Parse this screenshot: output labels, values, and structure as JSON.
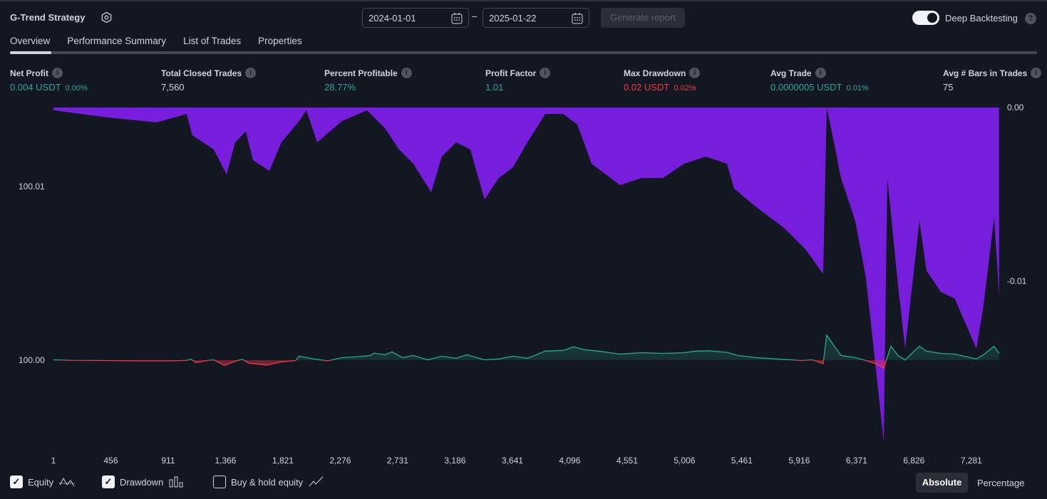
{
  "header": {
    "title": "G-Trend Strategy",
    "start_date": "2024-01-01",
    "end_date": "2025-01-22",
    "separator": "–",
    "generate_label": "Generate report",
    "deep_backtesting_label": "Deep Backtesting",
    "deep_backtesting_on": true,
    "help": "?"
  },
  "tabs": [
    {
      "label": "Overview",
      "active": true
    },
    {
      "label": "Performance Summary"
    },
    {
      "label": "List of Trades"
    },
    {
      "label": "Properties"
    }
  ],
  "metrics": [
    {
      "label": "Net Profit",
      "value": "0.004 USDT",
      "sub": "0.00%",
      "color": "g"
    },
    {
      "label": "Total Closed Trades",
      "value": "7,560",
      "sub": "",
      "color": "w"
    },
    {
      "label": "Percent Profitable",
      "value": "28.77%",
      "sub": "",
      "color": "g"
    },
    {
      "label": "Profit Factor",
      "value": "1.01",
      "sub": "",
      "color": "g"
    },
    {
      "label": "Max Drawdown",
      "value": "0.02 USDT",
      "sub": "0.02%",
      "color": "r"
    },
    {
      "label": "Avg Trade",
      "value": "0.0000005 USDT",
      "sub": "0.01%",
      "color": "g"
    },
    {
      "label": "Avg # Bars in Trades",
      "value": "75",
      "sub": "",
      "color": "w"
    }
  ],
  "info_glyph": "i",
  "chart_data": {
    "type": "line",
    "x_ticks": [
      "1",
      "456",
      "911",
      "1,366",
      "1,821",
      "2,276",
      "2,731",
      "3,186",
      "3,641",
      "4,096",
      "4,551",
      "5,006",
      "5,461",
      "5,916",
      "6,371",
      "6,826",
      "7,281"
    ],
    "y_left_ticks": [
      "100.01",
      "100.00"
    ],
    "y_right_ticks": [
      "0.00",
      "-0.01"
    ],
    "baseline": 100.0,
    "colors": {
      "equity_up": "#22ab94",
      "equity_down": "#f23645",
      "drawdown": "#7b1fe6"
    },
    "equity": [
      [
        1,
        100.00002
      ],
      [
        141,
        99.99999
      ],
      [
        425,
        99.99998
      ],
      [
        707,
        99.99996
      ],
      [
        933,
        99.99996
      ],
      [
        1057,
        99.99999
      ],
      [
        1091,
        100.00006
      ],
      [
        1131,
        99.99986
      ],
      [
        1215,
        99.99998
      ],
      [
        1272,
        100.00002
      ],
      [
        1357,
        99.9997
      ],
      [
        1442,
        99.99994
      ],
      [
        1498,
        100.00005
      ],
      [
        1555,
        99.99982
      ],
      [
        1696,
        99.99972
      ],
      [
        1809,
        99.9999
      ],
      [
        1922,
        99.99998
      ],
      [
        1950,
        100.00023
      ],
      [
        2064,
        100.00007
      ],
      [
        2177,
        99.99996
      ],
      [
        2290,
        100.00015
      ],
      [
        2403,
        100.00019
      ],
      [
        2516,
        100.00027
      ],
      [
        2545,
        100.00041
      ],
      [
        2629,
        100.00031
      ],
      [
        2686,
        100.00048
      ],
      [
        2771,
        100.00015
      ],
      [
        2855,
        100.00027
      ],
      [
        2968,
        100.00002
      ],
      [
        3081,
        100.00023
      ],
      [
        3194,
        100.00011
      ],
      [
        3279,
        100.00031
      ],
      [
        3420,
        100.00002
      ],
      [
        3533,
        100.00007
      ],
      [
        3646,
        100.00023
      ],
      [
        3760,
        100.00011
      ],
      [
        3901,
        100.00052
      ],
      [
        4043,
        100.00056
      ],
      [
        4127,
        100.00077
      ],
      [
        4212,
        100.0006
      ],
      [
        4325,
        100.00052
      ],
      [
        4495,
        100.00035
      ],
      [
        4664,
        100.00043
      ],
      [
        4834,
        100.00039
      ],
      [
        5003,
        100.00043
      ],
      [
        5088,
        100.00052
      ],
      [
        5201,
        100.00054
      ],
      [
        5343,
        100.00045
      ],
      [
        5428,
        100.00027
      ],
      [
        5569,
        100.00015
      ],
      [
        5739,
        100.00007
      ],
      [
        5852,
        100.00002
      ],
      [
        5936,
        99.99998
      ],
      [
        6021,
        100.00002
      ],
      [
        6106,
        99.9998
      ],
      [
        6134,
        100.00144
      ],
      [
        6191,
        100.00084
      ],
      [
        6247,
        100.00027
      ],
      [
        6360,
        100.00015
      ],
      [
        6445,
        99.99998
      ],
      [
        6530,
        99.99978
      ],
      [
        6586,
        99.99953
      ],
      [
        6643,
        100.0008
      ],
      [
        6699,
        100.00027
      ],
      [
        6756,
        100.00002
      ],
      [
        6869,
        100.0008
      ],
      [
        6925,
        100.00052
      ],
      [
        7038,
        100.00039
      ],
      [
        7151,
        100.00035
      ],
      [
        7321,
        100.00007
      ],
      [
        7377,
        100.00031
      ],
      [
        7462,
        100.0008
      ],
      [
        7501,
        100.00039
      ]
    ],
    "drawdown": [
      [
        1,
        0
      ],
      [
        2,
        -0.00016
      ],
      [
        425,
        -0.00057
      ],
      [
        820,
        -0.00086
      ],
      [
        1057,
        -0.00037
      ],
      [
        1102,
        -0.0016
      ],
      [
        1272,
        -0.00242
      ],
      [
        1374,
        -0.00385
      ],
      [
        1442,
        -0.00201
      ],
      [
        1527,
        -0.00139
      ],
      [
        1583,
        -0.00303
      ],
      [
        1713,
        -0.00365
      ],
      [
        1809,
        -0.00201
      ],
      [
        1950,
        -0.00078
      ],
      [
        2007,
        -0.00016
      ],
      [
        2092,
        -0.00201
      ],
      [
        2290,
        -0.00078
      ],
      [
        2488,
        -0.00016
      ],
      [
        2629,
        -0.00119
      ],
      [
        2742,
        -0.00242
      ],
      [
        2855,
        -0.00324
      ],
      [
        2997,
        -0.00488
      ],
      [
        3081,
        -0.00283
      ],
      [
        3194,
        -0.00201
      ],
      [
        3307,
        -0.00242
      ],
      [
        3420,
        -0.00529
      ],
      [
        3533,
        -0.00406
      ],
      [
        3646,
        -0.00344
      ],
      [
        3760,
        -0.00201
      ],
      [
        3901,
        -0.00037
      ],
      [
        4043,
        -0.00037
      ],
      [
        4156,
        -0.00098
      ],
      [
        4269,
        -0.00324
      ],
      [
        4495,
        -0.00447
      ],
      [
        4664,
        -0.00406
      ],
      [
        4834,
        -0.00406
      ],
      [
        5003,
        -0.00324
      ],
      [
        5173,
        -0.00283
      ],
      [
        5343,
        -0.00324
      ],
      [
        5399,
        -0.00467
      ],
      [
        5569,
        -0.0057
      ],
      [
        5795,
        -0.00693
      ],
      [
        5965,
        -0.00816
      ],
      [
        6106,
        -0.00959
      ],
      [
        6134,
        0
      ],
      [
        6191,
        -0.00201
      ],
      [
        6247,
        -0.00406
      ],
      [
        6360,
        -0.00652
      ],
      [
        6445,
        -0.0098
      ],
      [
        6586,
        -0.01922
      ],
      [
        6615,
        -0.00406
      ],
      [
        6699,
        -0.0102
      ],
      [
        6756,
        -0.01389
      ],
      [
        6869,
        -0.00652
      ],
      [
        6925,
        -0.00939
      ],
      [
        7038,
        -0.01061
      ],
      [
        7151,
        -0.01102
      ],
      [
        7321,
        -0.01389
      ],
      [
        7377,
        -0.01143
      ],
      [
        7462,
        -0.00631
      ],
      [
        7501,
        -0.01082
      ]
    ]
  },
  "legend": {
    "equity_label": "Equity",
    "equity_checked": true,
    "drawdown_label": "Drawdown",
    "drawdown_checked": true,
    "buyhold_label": "Buy & hold equity",
    "buyhold_checked": false,
    "check": "✓"
  },
  "view": {
    "absolute_label": "Absolute",
    "percentage_label": "Percentage",
    "selected": "Absolute"
  }
}
